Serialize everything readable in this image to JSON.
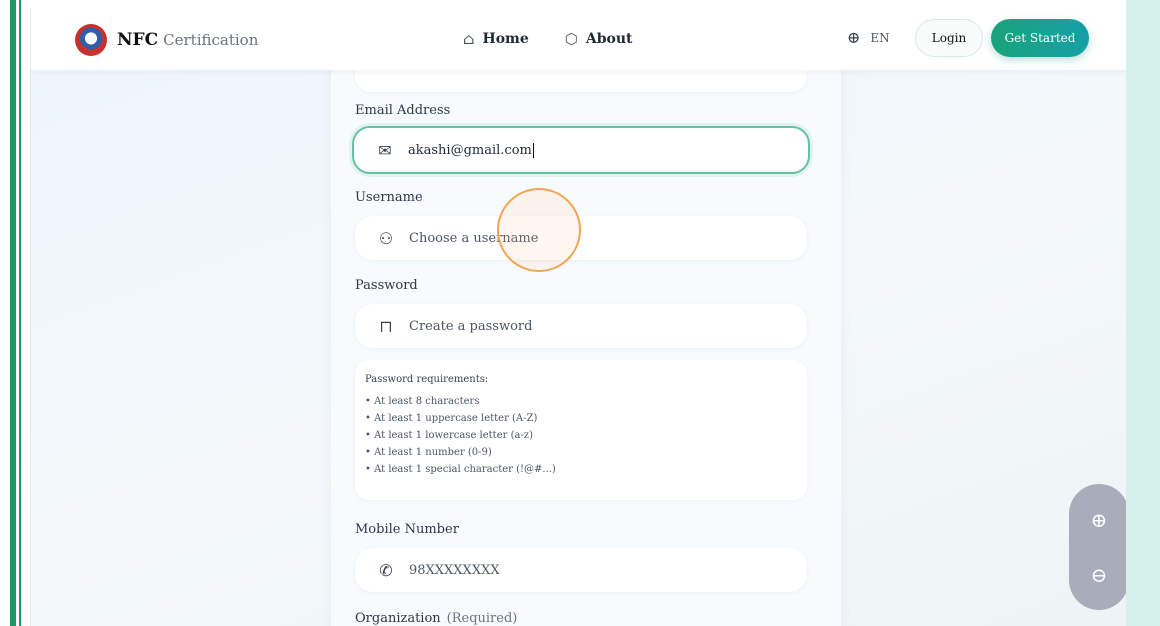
{
  "header": {
    "brand_main": "NFC",
    "brand_sub": "Certification",
    "nav": [
      {
        "label": "Home",
        "icon": "home-icon"
      },
      {
        "label": "About",
        "icon": "shield-icon"
      }
    ],
    "language": "EN",
    "login_label": "Login",
    "cta_label": "Get Started"
  },
  "form": {
    "email": {
      "label": "Email Address",
      "value": "akashi@gmail.com",
      "icon": "mail-icon"
    },
    "username": {
      "label": "Username",
      "placeholder": "Choose a username",
      "icon": "user-icon"
    },
    "password": {
      "label": "Password",
      "placeholder": "Create a password",
      "icon": "lock-icon"
    },
    "requirements": {
      "title": "Password requirements:",
      "items": [
        "• At least 8 characters",
        "• At least 1 uppercase letter (A-Z)",
        "• At least 1 lowercase letter (a-z)",
        "• At least 1 number (0-9)",
        "• At least 1 special character (!@#...)"
      ]
    },
    "mobile": {
      "label": "Mobile Number",
      "placeholder": "98XXXXXXXX",
      "icon": "phone-icon"
    },
    "organization": {
      "label": "Organization",
      "note": "(Required)"
    }
  },
  "zoom": {
    "in_icon": "zoom-in-icon",
    "out_icon": "zoom-out-icon"
  },
  "colors": {
    "accent": "#19a37a",
    "focus_border": "#62c3a4",
    "click_ring": "#f2a552"
  }
}
